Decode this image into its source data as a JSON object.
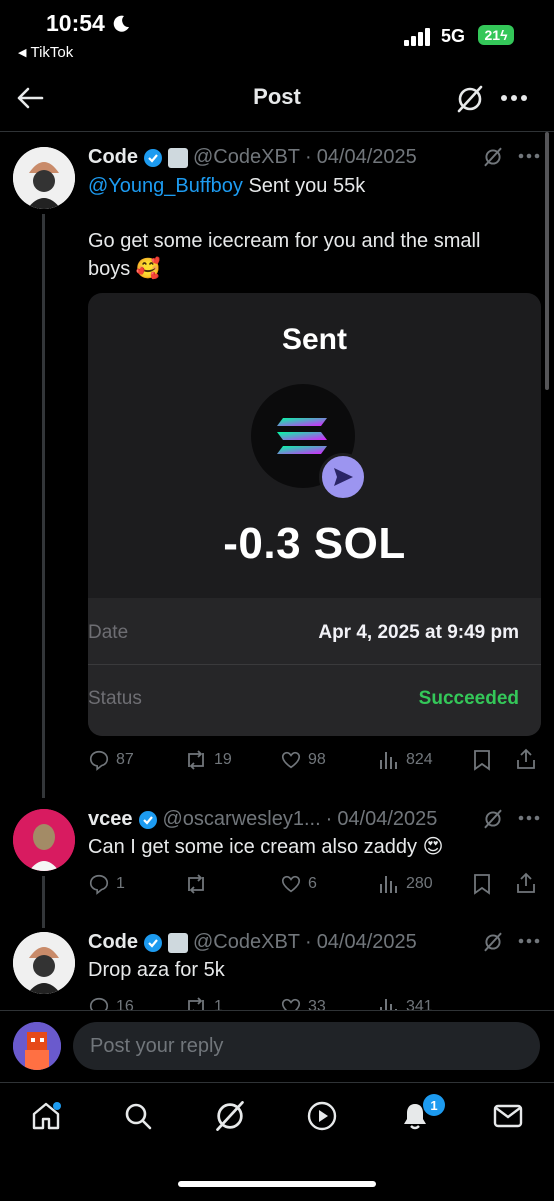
{
  "status_bar": {
    "time": "10:54",
    "back_app": "TikTok",
    "network": "5G",
    "battery": "21"
  },
  "header": {
    "title": "Post"
  },
  "tweets": [
    {
      "name": "Code",
      "handle": "@CodeXBT",
      "date": "04/04/2025",
      "mention": "@Young_Buffboy",
      "text_after_mention": " Sent you 55k",
      "text_line2": "Go get some icecream for you and the small boys 🥰",
      "stats": {
        "replies": "87",
        "reposts": "19",
        "likes": "98",
        "views": "824"
      }
    },
    {
      "name": "vcee",
      "handle": "@oscarwesley1...",
      "date": "04/04/2025",
      "text": "Can I get some ice cream also zaddy 😍",
      "stats": {
        "replies": "1",
        "reposts": "",
        "likes": "6",
        "views": "280"
      }
    },
    {
      "name": "Code",
      "handle": "@CodeXBT",
      "date": "04/04/2025",
      "text": "Drop aza for 5k",
      "stats": {
        "replies": "16",
        "reposts": "1",
        "likes": "33",
        "views": "341"
      }
    }
  ],
  "card": {
    "title": "Sent",
    "amount": "-0.3 SOL",
    "date_label": "Date",
    "date_value": "Apr 4, 2025 at 9:49 pm",
    "status_label": "Status",
    "status_value": "Succeeded"
  },
  "reply": {
    "placeholder": "Post your reply"
  },
  "tabbar": {
    "notifications_badge": "1"
  },
  "colors": {
    "accent": "#1d9bf0",
    "success": "#34c759",
    "background": "#000000"
  }
}
